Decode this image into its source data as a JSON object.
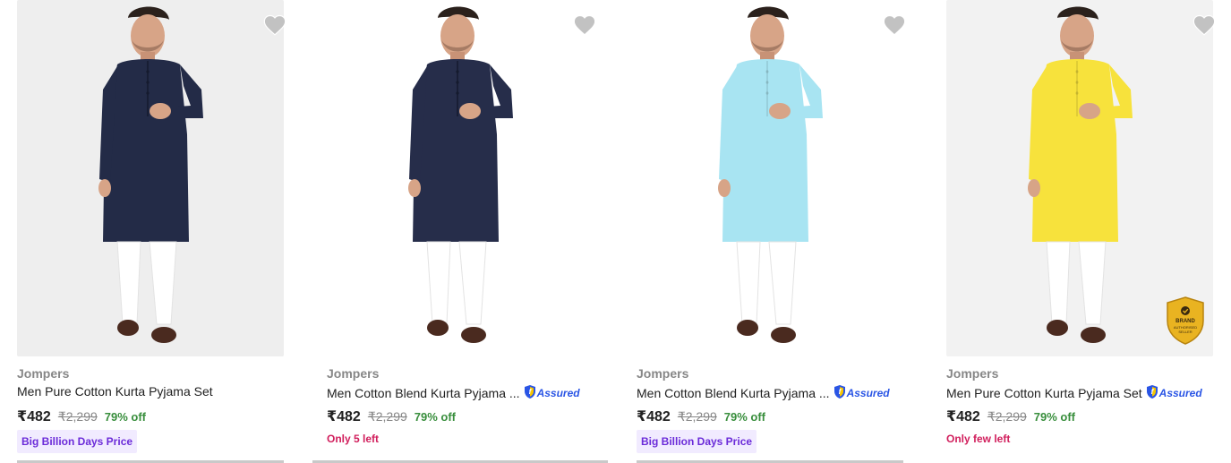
{
  "products": [
    {
      "brand": "Jompers",
      "title": "Men Pure Cotton Kurta Pyjama Set",
      "assured": false,
      "price": "₹482",
      "mrp": "₹2,299",
      "discount": "79% off",
      "tag": "Big Billion Days Price",
      "tag_type": "badge",
      "kurta_color": "#232b47",
      "bg_color": "#eeeeee",
      "brand_seal": false
    },
    {
      "brand": "Jompers",
      "title": "Men Cotton Blend Kurta Pyjama ...",
      "assured": true,
      "assured_label": "Assured",
      "price": "₹482",
      "mrp": "₹2,299",
      "discount": "79% off",
      "tag": "Only 5 left",
      "tag_type": "stock",
      "kurta_color": "#262d4a",
      "bg_color": "#ffffff",
      "brand_seal": false
    },
    {
      "brand": "Jompers",
      "title": "Men Cotton Blend Kurta Pyjama ...",
      "assured": true,
      "assured_label": "Assured",
      "price": "₹482",
      "mrp": "₹2,299",
      "discount": "79% off",
      "tag": "Big Billion Days Price",
      "tag_type": "badge",
      "kurta_color": "#a8e4f2",
      "bg_color": "#ffffff",
      "brand_seal": false
    },
    {
      "brand": "Jompers",
      "title": "Men Pure Cotton Kurta Pyjama Set",
      "assured": true,
      "assured_label": "Assured",
      "price": "₹482",
      "mrp": "₹2,299",
      "discount": "79% off",
      "tag": "Only few left",
      "tag_type": "stock",
      "kurta_color": "#f7e23c",
      "bg_color": "#f2f2f2",
      "brand_seal": true,
      "seal_text": [
        "BRAND",
        "AUTHORISED",
        "SELLER"
      ]
    }
  ],
  "icons": {
    "wishlist": "heart-icon",
    "assured": "assured-shield-icon"
  },
  "colors": {
    "price_discount": "#388e3c",
    "stock_warning": "#d11e5c",
    "badge_text": "#6b2bd9",
    "badge_bg": "#f1ebff",
    "assured_blue": "#2a55e5"
  }
}
